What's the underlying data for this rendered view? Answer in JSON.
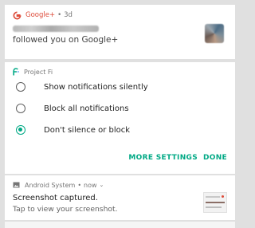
{
  "gplus_notification": {
    "app_name": "Google+",
    "separator": "•",
    "time": "3d",
    "message": "followed you on Google+",
    "accent_color": "#dd4b39"
  },
  "fi_settings": {
    "app_name": "Project Fi",
    "options": [
      {
        "label": "Show notifications silently",
        "selected": false
      },
      {
        "label": "Block all notifications",
        "selected": false
      },
      {
        "label": "Don't silence or block",
        "selected": true
      }
    ],
    "more_settings_label": "MORE SETTINGS",
    "done_label": "DONE",
    "accent_color": "#00a985"
  },
  "system_notification": {
    "app_name": "Android System",
    "separator": "•",
    "time": "now",
    "chevron": "⌄",
    "title": "Screenshot captured.",
    "subtitle": "Tap to view your screenshot."
  }
}
